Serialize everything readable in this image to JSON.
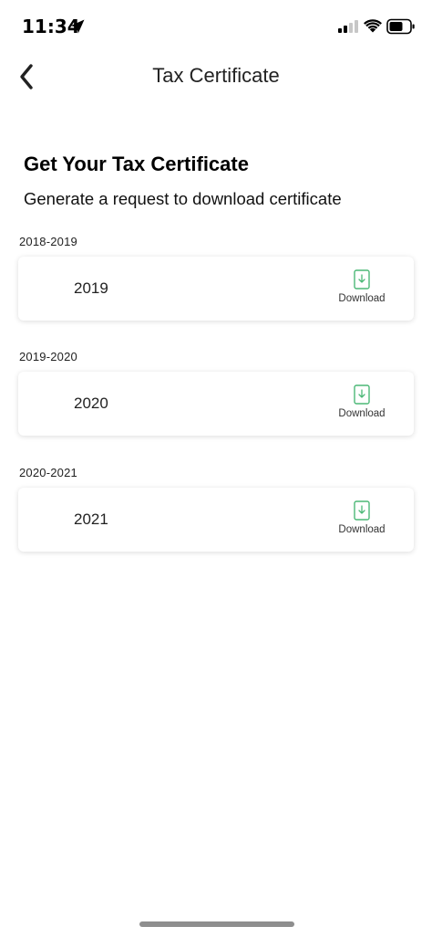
{
  "status_bar": {
    "time": "11:34",
    "icons": [
      "location-arrow-icon",
      "cellular-signal-icon",
      "wifi-icon",
      "battery-icon"
    ]
  },
  "nav": {
    "back_icon": "chevron-left-icon",
    "title": "Tax Certificate"
  },
  "header": {
    "heading": "Get Your Tax Certificate",
    "subheading": "Generate a request to download certificate"
  },
  "sections": [
    {
      "label": "2018-2019",
      "year": "2019",
      "action_label": "Download"
    },
    {
      "label": "2019-2020",
      "year": "2020",
      "action_label": "Download"
    },
    {
      "label": "2020-2021",
      "year": "2021",
      "action_label": "Download"
    }
  ],
  "colors": {
    "download_accent": "#4cb877",
    "text_primary": "#111111",
    "background": "#ffffff"
  }
}
